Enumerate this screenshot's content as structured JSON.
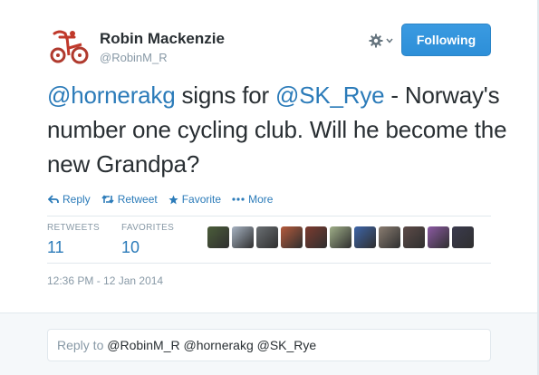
{
  "author": {
    "name": "Robin Mackenzie",
    "handle": "@RobinM_R",
    "avatar_icon": "red-tricycle-icon"
  },
  "follow_button": {
    "label": "Following"
  },
  "tweet": {
    "mention_1": "@hornerakg",
    "text_1": " signs for ",
    "mention_2": "@SK_Rye",
    "text_2": " - Norway's number one cycling club. Will he become the new Grandpa?"
  },
  "actions": {
    "reply": "Reply",
    "retweet": "Retweet",
    "favorite": "Favorite",
    "more": "More"
  },
  "stats": {
    "retweets_label": "RETWEETS",
    "retweets_count": "11",
    "favorites_label": "FAVORITES",
    "favorites_count": "10"
  },
  "favoriter_avatars": [
    {
      "color": "#4b5d3a"
    },
    {
      "color": "#a7b3c2"
    },
    {
      "color": "#6a6f73"
    },
    {
      "color": "#b55a3c"
    },
    {
      "color": "#7c3b2f"
    },
    {
      "color": "#9fae88"
    },
    {
      "color": "#3e65a8"
    },
    {
      "color": "#8a7d71"
    },
    {
      "color": "#5d4b48"
    },
    {
      "color": "#8c5aa3"
    },
    {
      "color": "#3b3b4e"
    }
  ],
  "timestamp": "12:36 PM - 12 Jan 2014",
  "reply_box": {
    "prefix": "Reply to ",
    "users": "@RobinM_R @hornerakg @SK_Rye"
  },
  "colors": {
    "link": "#2b7bb9",
    "follow_button": "#2d8fd8",
    "muted": "#8899a6"
  }
}
